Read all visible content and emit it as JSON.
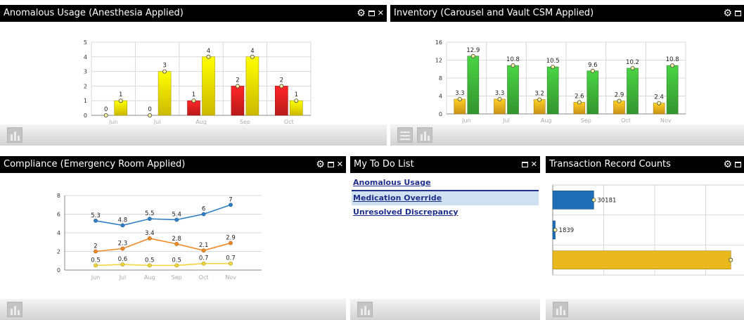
{
  "colors": {
    "red": "#e02020",
    "yellow": "#f7e000",
    "orange": "#f2b11d",
    "green": "#3fb43a",
    "line_blue": "#2f7fc6",
    "line_orange": "#f08a24",
    "line_yellow": "#f2d63a",
    "bar_blue": "#1f6fb8",
    "bar_gold": "#e8b81e",
    "link": "#1f2f8c",
    "highlight": "#cfe0f0"
  },
  "icons": {
    "settings": "gear-icon",
    "minimize": "minimize-icon",
    "close": "close-icon",
    "footer": "chart-icon"
  },
  "panels": {
    "anomalous": {
      "title": "Anomalous Usage (Anesthesia Applied)"
    },
    "inventory": {
      "title": "Inventory (Carousel and Vault CSM Applied)"
    },
    "compliance": {
      "title": "Compliance (Emergency Room Applied)"
    },
    "todo": {
      "title": "My To Do List",
      "items": [
        {
          "label": "Anomalous Usage"
        },
        {
          "label": "Medication Override"
        },
        {
          "label": "Unresolved Discrepancy"
        }
      ]
    },
    "transactions": {
      "title": "Transaction Record Counts"
    }
  },
  "chart_data": [
    {
      "id": "anomalous",
      "type": "bar",
      "categories": [
        "Jun",
        "Jul",
        "Aug",
        "Sep",
        "Oct"
      ],
      "series": [
        {
          "values": [
            0,
            0,
            1,
            2,
            2
          ],
          "color": "#e02020"
        },
        {
          "values": [
            1,
            3,
            4,
            4,
            1
          ],
          "color": "#f7e000"
        }
      ],
      "ylim": [
        0,
        5
      ],
      "yticks": [
        0,
        1,
        2,
        3,
        4,
        5
      ],
      "grid": true
    },
    {
      "id": "inventory",
      "type": "bar",
      "categories": [
        "Jun",
        "Jul",
        "Aug",
        "Sep",
        "Oct",
        "Nov"
      ],
      "series": [
        {
          "values": [
            3.3,
            3.3,
            3.2,
            2.6,
            2.9,
            2.4
          ],
          "color": "#f2b11d"
        },
        {
          "values": [
            12.9,
            10.8,
            10.5,
            9.6,
            10.2,
            10.8
          ],
          "color": "#3fb43a"
        }
      ],
      "ylim": [
        0,
        16
      ],
      "yticks": [
        0,
        4,
        8,
        12,
        16
      ],
      "grid": true
    },
    {
      "id": "compliance",
      "type": "line",
      "categories": [
        "Jun",
        "Jul",
        "Aug",
        "Sep",
        "Oct",
        "Nov"
      ],
      "series": [
        {
          "values": [
            5.3,
            4.8,
            5.5,
            5.4,
            6,
            7
          ],
          "color": "#2f7fc6"
        },
        {
          "values": [
            2,
            2.3,
            3.4,
            2.8,
            2.1,
            2.9
          ],
          "color": "#f08a24"
        },
        {
          "values": [
            0.5,
            0.6,
            0.5,
            0.5,
            0.7,
            0.7
          ],
          "color": "#f2d63a"
        }
      ],
      "ylim": [
        0,
        8
      ],
      "yticks": [
        0,
        2,
        4,
        6,
        8
      ],
      "grid": true
    },
    {
      "id": "transactions",
      "type": "bar",
      "orientation": "horizontal",
      "values": [
        30181,
        1839,
        131000
      ],
      "value_labels": [
        "30181",
        "1839",
        ""
      ],
      "colors": [
        "#1f6fb8",
        "#1f6fb8",
        "#e8b81e"
      ],
      "xlim": [
        0,
        150000
      ],
      "grid": true
    }
  ]
}
